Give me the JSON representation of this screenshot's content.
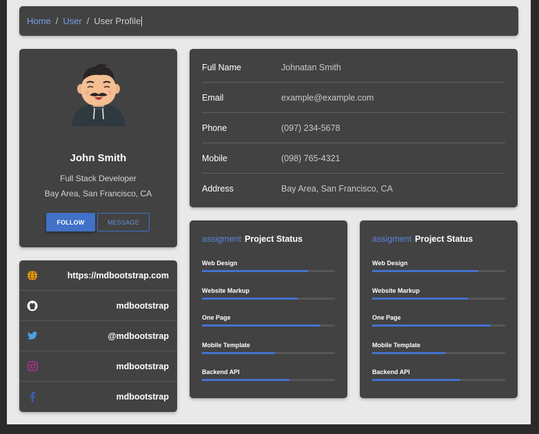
{
  "breadcrumb": {
    "items": [
      "Home",
      "User"
    ],
    "separator": "/",
    "current": "User Profile"
  },
  "profile": {
    "name": "John Smith",
    "role": "Full Stack Developer",
    "location": "Bay Area, San Francisco, CA",
    "follow_label": "FOLLOW",
    "message_label": "MESSAGE"
  },
  "social": [
    {
      "icon": "globe-icon",
      "text": "https://mdbootstrap.com",
      "color": "#f0a920"
    },
    {
      "icon": "github-icon",
      "text": "mdbootstrap",
      "color": "#ffffff"
    },
    {
      "icon": "twitter-icon",
      "text": "@mdbootstrap",
      "color": "#4aa1e6"
    },
    {
      "icon": "instagram-icon",
      "text": "mdbootstrap",
      "color": "#b4318f"
    },
    {
      "icon": "facebook-icon",
      "text": "mdbootstrap",
      "color": "#3b5cad"
    }
  ],
  "info": [
    {
      "label": "Full Name",
      "value": "Johnatan Smith"
    },
    {
      "label": "Email",
      "value": "example@example.com"
    },
    {
      "label": "Phone",
      "value": "(097) 234-5678"
    },
    {
      "label": "Mobile",
      "value": "(098) 765-4321"
    },
    {
      "label": "Address",
      "value": "Bay Area, San Francisco, CA"
    }
  ],
  "projects": [
    {
      "accent": "assigment",
      "title": "Project Status",
      "bars": [
        {
          "label": "Web Design",
          "percent": 80
        },
        {
          "label": "Website Markup",
          "percent": 72
        },
        {
          "label": "One Page",
          "percent": 89
        },
        {
          "label": "Mobile Template",
          "percent": 55
        },
        {
          "label": "Backend API",
          "percent": 66
        }
      ]
    },
    {
      "accent": "assigment",
      "title": "Project Status",
      "bars": [
        {
          "label": "Web Design",
          "percent": 80
        },
        {
          "label": "Website Markup",
          "percent": 72
        },
        {
          "label": "One Page",
          "percent": 89
        },
        {
          "label": "Mobile Template",
          "percent": 55
        },
        {
          "label": "Backend API",
          "percent": 66
        }
      ]
    }
  ],
  "colors": {
    "accent": "#4171c8",
    "card": "#424242",
    "background": "#e9e9e9"
  }
}
